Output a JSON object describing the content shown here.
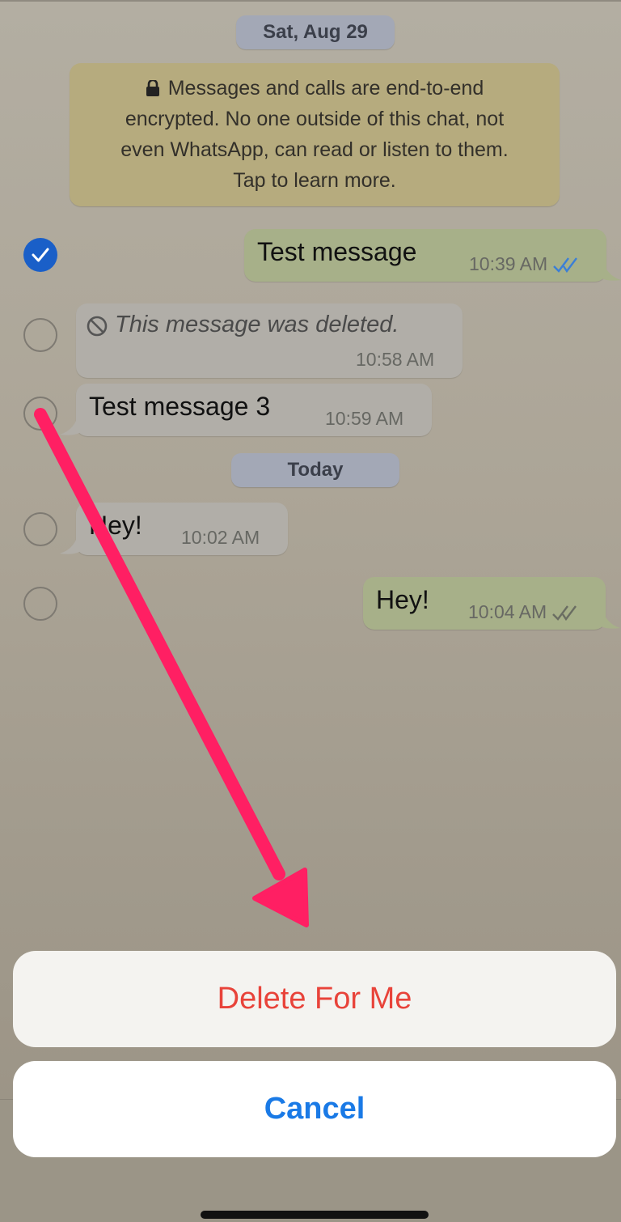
{
  "chat": {
    "date_header_1": "Sat, Aug 29",
    "encryption_notice": {
      "line1": "Messages and calls are end-to-end",
      "line2": "encrypted. No one outside of this chat, not",
      "line3": "even WhatsApp, can read or listen to them.",
      "line4": "Tap to learn more."
    },
    "date_header_2": "Today",
    "messages": [
      {
        "text": "Test message",
        "time": "10:39 AM",
        "direction": "outgoing",
        "selected": true,
        "ticks": "read"
      },
      {
        "text": "This message was deleted.",
        "time": "10:58 AM",
        "direction": "incoming",
        "selected": false,
        "deleted": true
      },
      {
        "text": "Test message 3",
        "time": "10:59 AM",
        "direction": "incoming",
        "selected": false
      },
      {
        "text": "Hey!",
        "time": "10:02 AM",
        "direction": "incoming",
        "selected": false
      },
      {
        "text": "Hey!",
        "time": "10:04 AM",
        "direction": "outgoing",
        "selected": false,
        "ticks": "delivered"
      }
    ]
  },
  "action_sheet": {
    "delete_label": "Delete For Me",
    "cancel_label": "Cancel"
  },
  "colors": {
    "delete": "#e8433a",
    "cancel": "#1a7ae6",
    "checked": "#1a5fc8",
    "arrow": "#ff1f63",
    "read_ticks": "#3b7fd6"
  },
  "icons": {
    "lock": "lock-icon",
    "deleted": "prohibited-icon",
    "ticks": "double-check-icon",
    "selected": "checkmark-icon"
  }
}
